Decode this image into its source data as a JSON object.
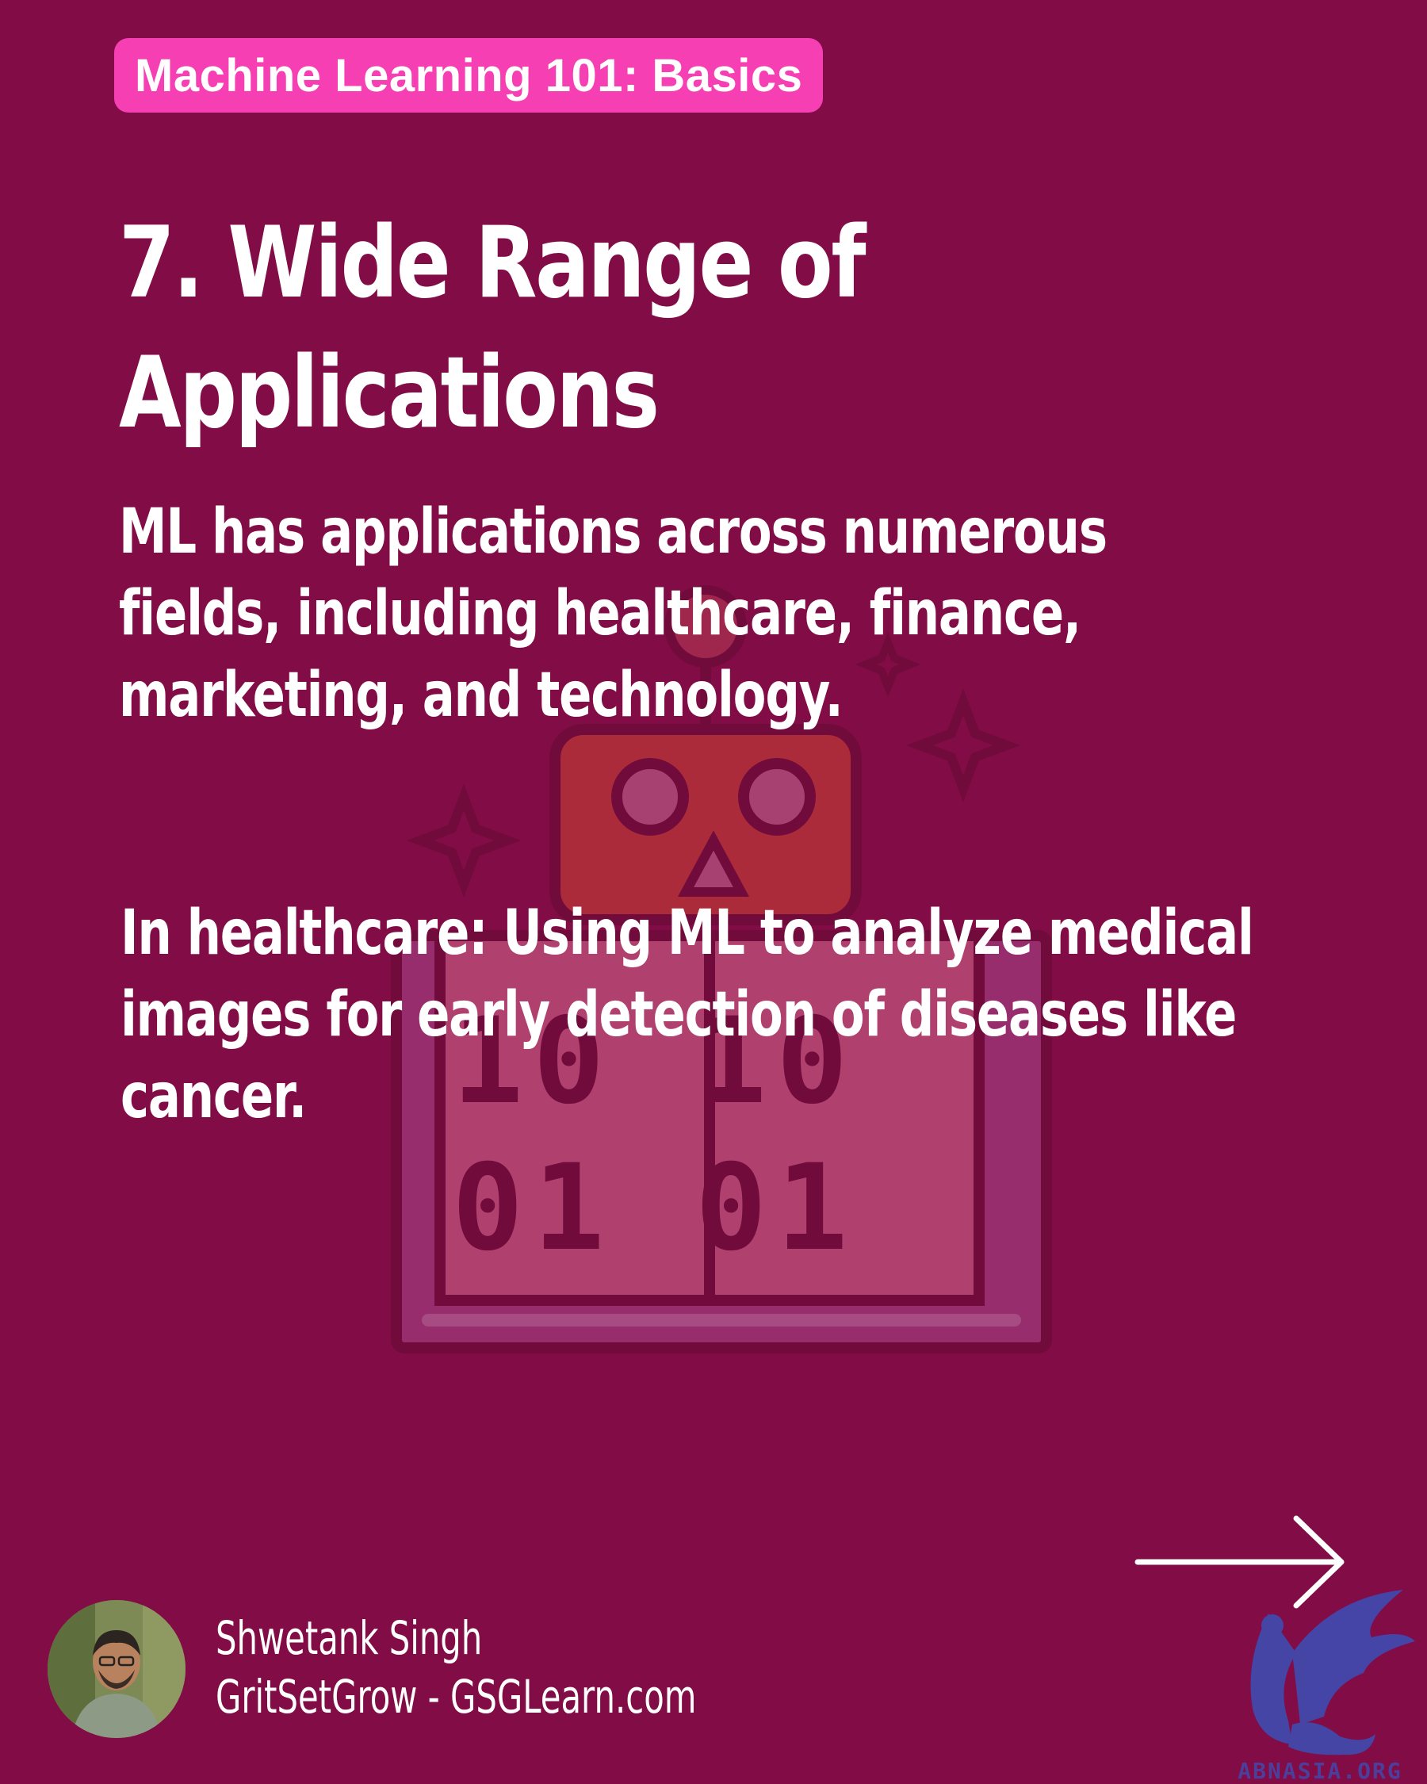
{
  "badge": {
    "label": "Machine Learning 101: Basics"
  },
  "title": {
    "line1": "7. Wide Range of",
    "line2": "Applications"
  },
  "intro": {
    "line1": "ML has applications across numerous",
    "line2": "fields, including healthcare, finance,",
    "line3": "marketing, and technology."
  },
  "example": {
    "line1": "In healthcare: Using ML to analyze medical",
    "line2": "images for early detection of diseases like",
    "line3": "cancer."
  },
  "illustration": {
    "row1": "10 10",
    "row2": "01 01"
  },
  "author": {
    "name": "Shwetank Singh",
    "site": "GritSetGrow - GSGLearn.com"
  },
  "watermark": {
    "text": "ABNASIA.ORG"
  },
  "colors": {
    "background": "#820c45",
    "badge": "#f53fb2",
    "text": "#ffffff"
  },
  "icons": [
    "robot-book-illustration",
    "right-arrow-icon",
    "author-avatar",
    "griffin-logo"
  ]
}
